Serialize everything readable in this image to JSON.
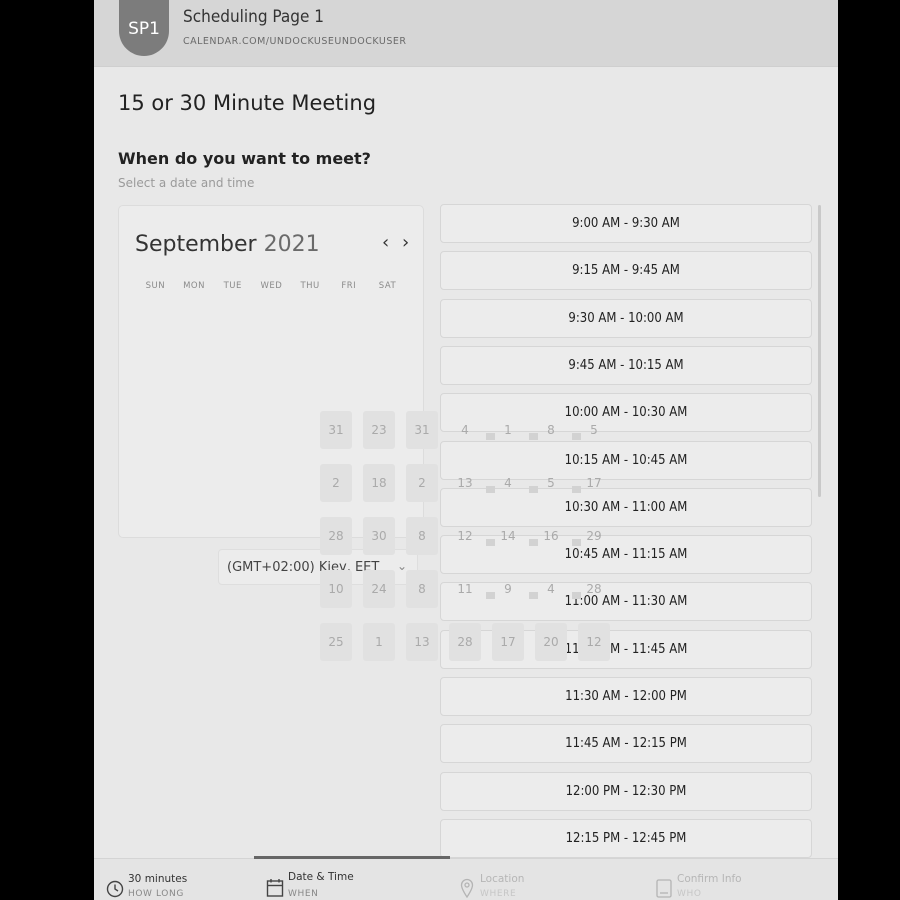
{
  "header": {
    "avatar": "SP1",
    "title": "Scheduling Page 1",
    "url": "CALENDAR.COM/UNDOCKUSEUNDOCKUSER"
  },
  "meeting_title": "15 or 30 Minute Meeting",
  "question": "When do you want to meet?",
  "hint": "Select a date and time",
  "calendar": {
    "month": "September",
    "year": "2021",
    "prev": "‹",
    "next": "›",
    "weekdays": [
      "SUN",
      "MON",
      "TUE",
      "WED",
      "THU",
      "FRI",
      "SAT"
    ],
    "days": [
      [
        "31",
        "23",
        "31",
        "4",
        "1",
        "8",
        "5"
      ],
      [
        "2",
        "18",
        "2",
        "13",
        "4",
        "5",
        "17"
      ],
      [
        "28",
        "30",
        "8",
        "12",
        "14",
        "16",
        "29"
      ],
      [
        "10",
        "24",
        "8",
        "11",
        "9",
        "4",
        "28"
      ],
      [
        "25",
        "1",
        "13",
        "28",
        "17",
        "20",
        "12"
      ]
    ]
  },
  "timezone": {
    "value": "(GMT+02:00) Kiev, EET",
    "chevron": "⌄"
  },
  "time_slots": [
    "9:00 AM - 9:30 AM",
    "9:15 AM - 9:45 AM",
    "9:30 AM - 10:00 AM",
    "9:45 AM - 10:15 AM",
    "10:00 AM - 10:30 AM",
    "10:15 AM - 10:45 AM",
    "10:30 AM - 11:00 AM",
    "10:45 AM - 11:15 AM",
    "11:00 AM - 11:30 AM",
    "11:15 AM - 11:45 AM",
    "11:30 AM - 12:00 PM",
    "11:45 AM - 12:15 PM",
    "12:00 PM - 12:30 PM",
    "12:15 PM - 12:45 PM"
  ],
  "steps": [
    {
      "label": "30 minutes",
      "sub": "HOW LONG",
      "icon": "clock-icon"
    },
    {
      "label": "Date & Time",
      "sub": "WHEN",
      "icon": "calendar-icon"
    },
    {
      "label": "Location",
      "sub": "WHERE",
      "icon": "location-pin-icon"
    },
    {
      "label": "Confirm Info",
      "sub": "WHO",
      "icon": "document-icon"
    }
  ]
}
